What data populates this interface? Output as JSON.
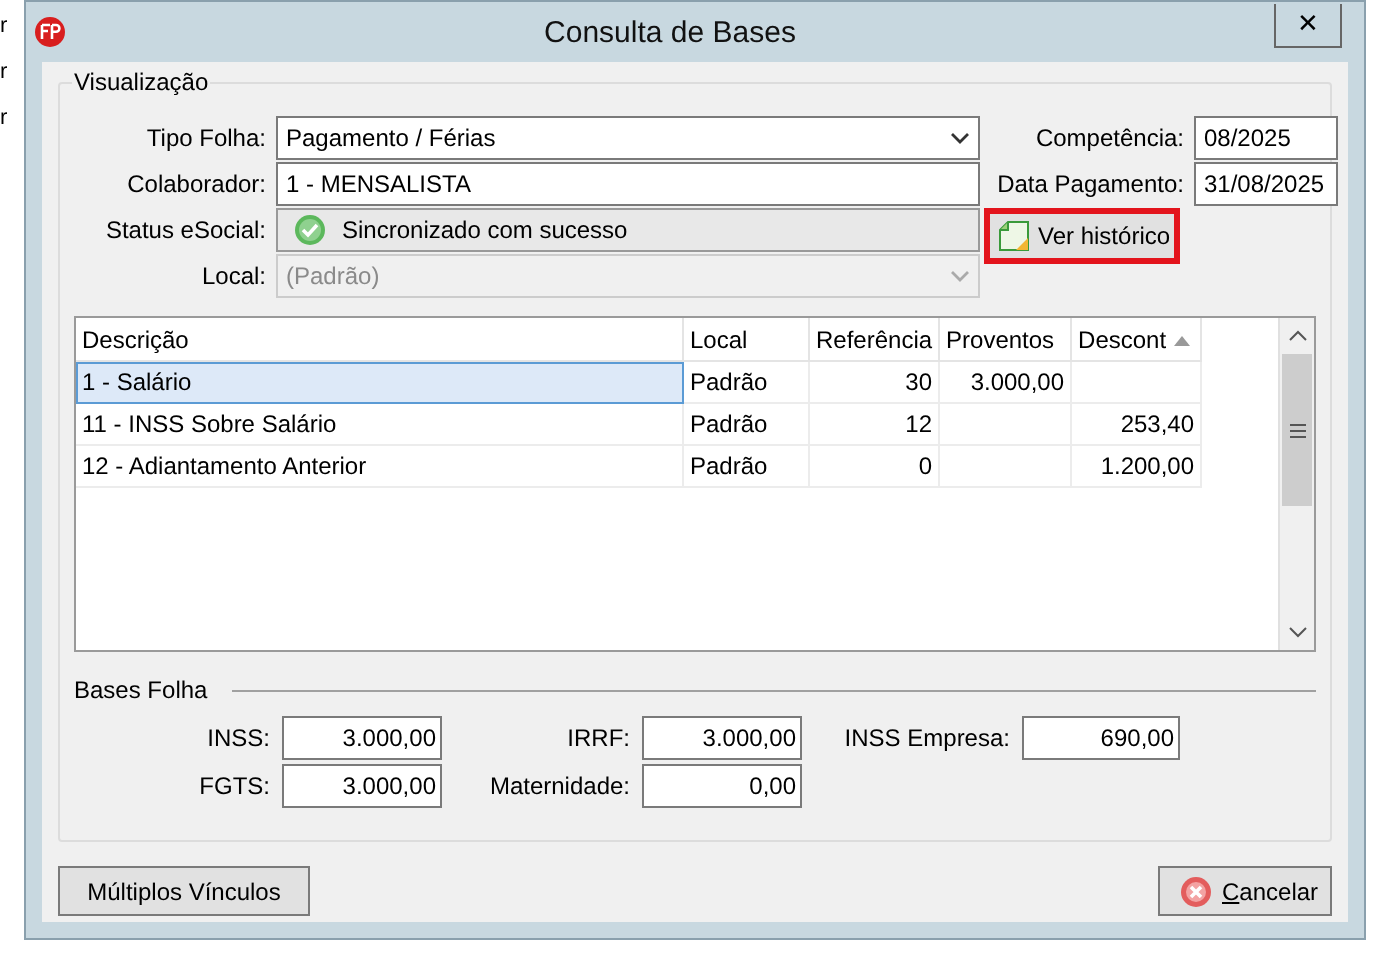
{
  "background_window": {
    "lines": [
      "r",
      "r",
      "r"
    ]
  },
  "window": {
    "title": "Consulta de Bases",
    "close": "✕"
  },
  "visualizacao": {
    "legend": "Visualização",
    "fields": [
      {
        "label": "Tipo Folha:",
        "value": "Pagamento / Férias",
        "kind": "dropdown",
        "disabled": false
      },
      {
        "label": "Colaborador:",
        "value": "1 - MENSALISTA",
        "kind": "text",
        "disabled": false
      },
      {
        "label": "Status eSocial:",
        "value": "Sincronizado com sucesso",
        "kind": "status",
        "disabled": false
      },
      {
        "label": "Local:",
        "value": "(Padrão)",
        "kind": "dropdown",
        "disabled": true
      }
    ],
    "right_fields": [
      {
        "label": "Competência:",
        "value": "08/2025"
      },
      {
        "label": "Data Pagamento:",
        "value": "31/08/2025"
      }
    ],
    "history_button": {
      "label": "Ver histórico",
      "highlighted": true
    }
  },
  "table": {
    "columns": [
      {
        "label": "Descrição",
        "sorted": false
      },
      {
        "label": "Local",
        "sorted": false
      },
      {
        "label": "Referência",
        "sorted": false
      },
      {
        "label": "Proventos",
        "sorted": false
      },
      {
        "label": "Descont",
        "sorted": true
      }
    ],
    "rows": [
      {
        "selected": true,
        "cells": [
          "1 - Salário",
          "Padrão",
          "30",
          "3.000,00",
          ""
        ]
      },
      {
        "selected": false,
        "cells": [
          "11 - INSS Sobre Salário",
          "Padrão",
          "12",
          "",
          "253,40"
        ]
      },
      {
        "selected": false,
        "cells": [
          "12 - Adiantamento Anterior",
          "Padrão",
          "0",
          "",
          "1.200,00"
        ]
      }
    ]
  },
  "bases_folha": {
    "legend": "Bases Folha",
    "fields": [
      {
        "label": "INSS:",
        "value": "3.000,00"
      },
      {
        "label": "IRRF:",
        "value": "3.000,00"
      },
      {
        "label": "INSS Empresa:",
        "value": "690,00"
      },
      {
        "label": "FGTS:",
        "value": "3.000,00"
      },
      {
        "label": "Maternidade:",
        "value": "0,00"
      }
    ]
  },
  "buttons": [
    {
      "label": "Múltiplos Vínculos",
      "kind": "plain"
    },
    {
      "label": "Cancelar",
      "kind": "cancel"
    }
  ]
}
